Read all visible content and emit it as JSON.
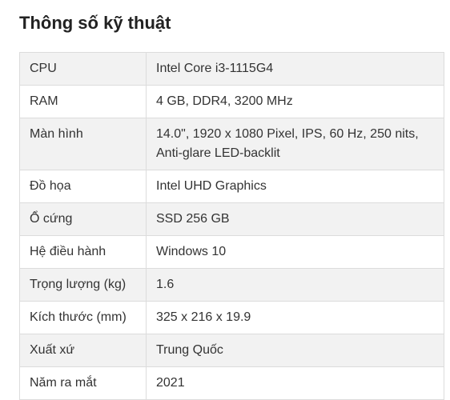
{
  "heading": "Thông số kỹ thuật",
  "rows": [
    {
      "label": "CPU",
      "value": "Intel Core i3-1115G4"
    },
    {
      "label": "RAM",
      "value": "4 GB, DDR4, 3200 MHz"
    },
    {
      "label": "Màn hình",
      "value_lines": [
        "14.0\", 1920 x 1080 Pixel, IPS, 60 Hz, 250 nits,",
        "Anti-glare LED-backlit"
      ]
    },
    {
      "label": "Đồ họa",
      "value": "Intel UHD Graphics"
    },
    {
      "label": "Ổ cứng",
      "value": "SSD 256 GB"
    },
    {
      "label": "Hệ điều hành",
      "value": "Windows 10"
    },
    {
      "label": "Trọng lượng (kg)",
      "value": "1.6"
    },
    {
      "label": "Kích thước (mm)",
      "value": "325 x 216 x 19.9"
    },
    {
      "label": "Xuất xứ",
      "value": "Trung Quốc"
    },
    {
      "label": "Năm ra mắt",
      "value": "2021"
    }
  ],
  "colors": {
    "stripe": "#f2f2f2",
    "border": "#dcdcdc",
    "text": "#333333"
  }
}
